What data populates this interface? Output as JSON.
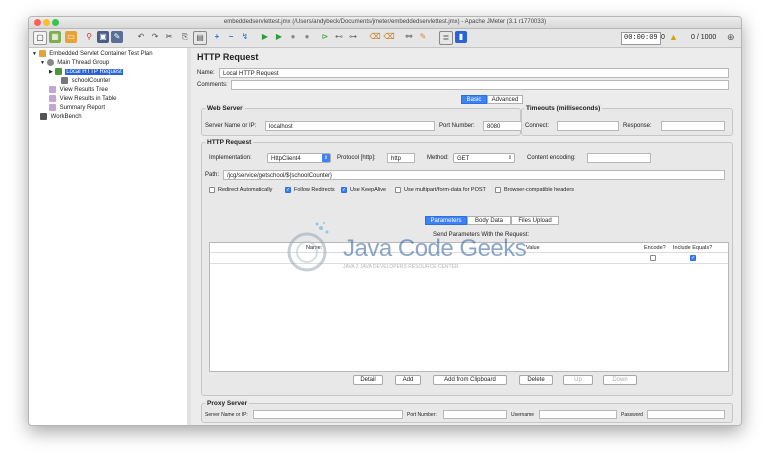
{
  "window": {
    "title": "embeddedservlettest.jmx (/Users/andybeck/Documents/jmeter/embeddedservlettest.jmx) - Apache JMeter (3.1 r1770033)"
  },
  "toolbar": {
    "timer": "00:00:09",
    "active_threads": "0",
    "thread_count": "0 / 1000",
    "icons": [
      "new-icon",
      "templates-icon",
      "open-icon",
      "close-icon",
      "save-icon",
      "save-as-icon",
      "cut-icon",
      "copy-icon",
      "paste-icon",
      "expand-icon",
      "collapse-icon",
      "toggle-icon",
      "start-icon",
      "start-no-pause-icon",
      "stop-icon",
      "shutdown-icon",
      "remote-start-icon",
      "remote-stop-icon",
      "remote-shutdown-icon",
      "clear-icon",
      "clear-all-icon",
      "search-icon",
      "reset-search-icon",
      "function-helper-icon",
      "help-icon"
    ],
    "warning_icon": "warning-icon",
    "globe_icon": "globe-icon"
  },
  "tree": {
    "items": [
      {
        "label": "Embedded Servlet Container Test Plan",
        "icon": "test-plan-icon"
      },
      {
        "label": "Main Thread Group",
        "icon": "thread-group-icon"
      },
      {
        "label": "Local HTTP Request",
        "icon": "http-request-icon"
      },
      {
        "label": "schoolCounter",
        "icon": "counter-icon"
      },
      {
        "label": "View Results Tree",
        "icon": "listener-icon"
      },
      {
        "label": "View Results in Table",
        "icon": "listener-icon"
      },
      {
        "label": "Summary Report",
        "icon": "listener-icon"
      },
      {
        "label": "WorkBench",
        "icon": "workbench-icon"
      }
    ]
  },
  "sampler": {
    "heading": "HTTP Request",
    "name_label": "Name:",
    "name_value": "Local HTTP Request",
    "comments_label": "Comments:",
    "comments_value": "",
    "tabs": [
      "Basic",
      "Advanced"
    ],
    "web_server": {
      "title": "Web Server",
      "server_label": "Server Name or IP:",
      "server_value": "localhost",
      "port_label": "Port Number:",
      "port_value": "8080"
    },
    "timeouts": {
      "title": "Timeouts (milliseconds)",
      "connect_label": "Connect:",
      "connect_value": "",
      "response_label": "Response:",
      "response_value": ""
    },
    "http_request": {
      "title": "HTTP Request",
      "implementation_label": "Implementation:",
      "implementation_value": "HttpClient4",
      "protocol_label": "Protocol [http]:",
      "protocol_value": "http",
      "method_label": "Method:",
      "method_value": "GET",
      "encoding_label": "Content encoding:",
      "encoding_value": "",
      "path_label": "Path:",
      "path_value": "/jcg/service/getschool/${schoolCounter}"
    },
    "options": [
      {
        "label": "Redirect Automatically",
        "checked": false
      },
      {
        "label": "Follow Redirects",
        "checked": true
      },
      {
        "label": "Use KeepAlive",
        "checked": true
      },
      {
        "label": "Use multipart/form-data for POST",
        "checked": false
      },
      {
        "label": "Browser-compatible headers",
        "checked": false
      }
    ],
    "param_tabs": [
      "Parameters",
      "Body Data",
      "Files Upload"
    ],
    "params_table": {
      "caption": "Send Parameters With the Request:",
      "columns": [
        "Name:",
        "Value",
        "Encode?",
        "Include Equals?"
      ],
      "rows": [
        {
          "encode": false,
          "include_equals": true
        }
      ]
    },
    "buttons": {
      "detail": "Detail",
      "add": "Add",
      "add_from_clipboard": "Add from Clipboard",
      "delete": "Delete",
      "up": "Up",
      "down": "Down"
    },
    "proxy": {
      "title": "Proxy Server",
      "server_label": "Server Name or IP:",
      "port_label": "Port Number:",
      "username_label": "Username",
      "password_label": "Password"
    }
  },
  "watermark": {
    "title": "Java Code Geeks",
    "subtitle": "JAVA 2 JAVA DEVELOPERS RESOURCE CENTER"
  },
  "colors": {
    "accent": "#3d82f5",
    "selection": "#2a63d6"
  }
}
